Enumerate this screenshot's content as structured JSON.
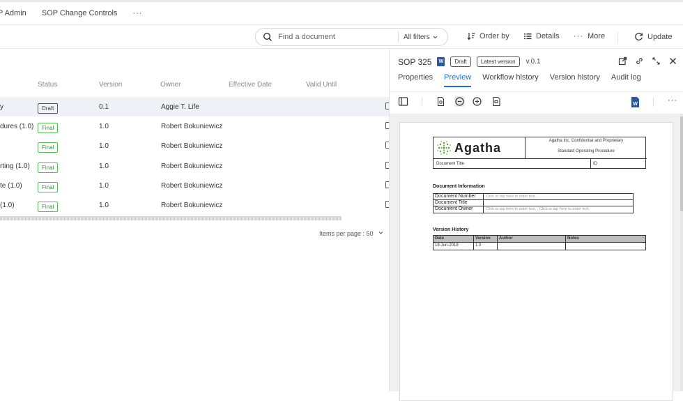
{
  "topnav": {
    "tabs": [
      "P Admin",
      "SOP Change Controls"
    ],
    "more": "···"
  },
  "toolbar": {
    "search_placeholder": "Find a document",
    "filters": "All filters",
    "order_by": "Order by",
    "details": "Details",
    "more": "More",
    "update": "Update"
  },
  "table": {
    "columns": [
      "Status",
      "Version",
      "Owner",
      "Effective Date",
      "Valid Until"
    ],
    "rows": [
      {
        "title": "y",
        "status": "Draft",
        "version": "0.1",
        "owner": "Aggie T. Life"
      },
      {
        "title": "dures (1.0)",
        "status": "Final",
        "version": "1.0",
        "owner": "Robert Bokuniewicz"
      },
      {
        "title": "",
        "status": "Final",
        "version": "1.0",
        "owner": "Robert Bokuniewicz"
      },
      {
        "title": "rting (1.0)",
        "status": "Final",
        "version": "1.0",
        "owner": "Robert Bokuniewicz"
      },
      {
        "title": "te (1.0)",
        "status": "Final",
        "version": "1.0",
        "owner": "Robert Bokuniewicz"
      },
      {
        "title": " (1.0)",
        "status": "Final",
        "version": "1.0",
        "owner": "Robert Bokuniewicz"
      }
    ],
    "items_per_page": "Items per page : 50"
  },
  "panel": {
    "doc_id": "SOP 325",
    "word_badge": "W",
    "status": "Draft",
    "latest": "Latest version",
    "version": "v.0.1",
    "tabs": [
      "Properties",
      "Preview",
      "Workflow history",
      "Version history",
      "Audit log"
    ],
    "active_tab": "Preview"
  },
  "document": {
    "logo": "Agatha",
    "confidential": "Agatha Inc. Confidential and Proprietary",
    "sop_label": "Standard Operating Procedure",
    "doc_title_label": "Document Title",
    "id_label": "ID",
    "info_heading": "Document Information",
    "info": [
      {
        "k": "Document Number",
        "v": "Click or tap here to enter text."
      },
      {
        "k": "Document Title",
        "v": ""
      },
      {
        "k": "Document Owner",
        "v": "Click or tap here to enter text. , Click or tap here to enter text."
      }
    ],
    "vh_heading": "Version History",
    "vh_cols": [
      "Date",
      "Version",
      "Author",
      "Notes"
    ],
    "vh_rows": [
      [
        "18-Jun-2018",
        "1.0",
        "",
        ""
      ]
    ]
  },
  "colors": {
    "accent": "#1a73d0",
    "final_green": "#5cb85c",
    "word_blue": "#2b579a"
  }
}
